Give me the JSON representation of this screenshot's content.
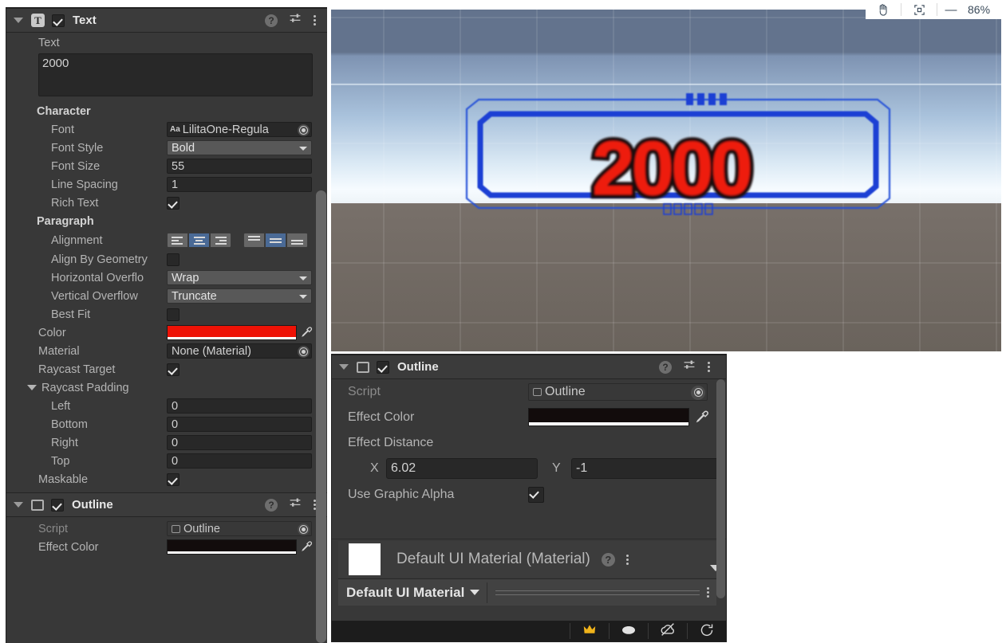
{
  "toolbar": {
    "hand_tool": "hand-tool",
    "frame_tool": "frame-selected-tool",
    "minus": "—",
    "zoom_level": "86%"
  },
  "game_view": {
    "text_value": "2000",
    "text_color": "#ee1c10",
    "outline_color": "#1a0d0d",
    "frame_color": "#1b3fd4",
    "sky_top": "#62728c",
    "sky_mid": "#b9cbdf",
    "ground": "#6e675f",
    "tick_marks_top": 4,
    "tick_marks_bottom": 5
  },
  "text_component": {
    "header": {
      "title": "Text",
      "icon": "text-component-icon",
      "enabled": true,
      "help": "help-icon",
      "preset": "preset-icon",
      "menu": "kebab-menu-icon"
    },
    "text_label": "Text",
    "text_area_value": "2000",
    "character_section": "Character",
    "font_label": "Font",
    "font_value": "LilitaOne-Regula",
    "font_icon": "Aa",
    "font_style_label": "Font Style",
    "font_style_value": "Bold",
    "font_size_label": "Font Size",
    "font_size_value": "55",
    "line_spacing_label": "Line Spacing",
    "line_spacing_value": "1",
    "rich_text_label": "Rich Text",
    "rich_text_checked": true,
    "paragraph_section": "Paragraph",
    "alignment_label": "Alignment",
    "alignment_horizontal_selected": 1,
    "alignment_vertical_selected": 1,
    "align_by_geometry_label": "Align By Geometry",
    "align_by_geometry_checked": false,
    "horizontal_overflow_label": "Horizontal Overflo",
    "horizontal_overflow_value": "Wrap",
    "vertical_overflow_label": "Vertical Overflow",
    "vertical_overflow_value": "Truncate",
    "best_fit_label": "Best Fit",
    "best_fit_checked": false,
    "color_label": "Color",
    "color_value": "#ee1206",
    "material_label": "Material",
    "material_value": "None (Material)",
    "raycast_target_label": "Raycast Target",
    "raycast_target_checked": true,
    "raycast_padding_label": "Raycast Padding",
    "padding": [
      {
        "label": "Left",
        "value": "0"
      },
      {
        "label": "Bottom",
        "value": "0"
      },
      {
        "label": "Right",
        "value": "0"
      },
      {
        "label": "Top",
        "value": "0"
      }
    ],
    "maskable_label": "Maskable",
    "maskable_checked": true
  },
  "outline_component_left": {
    "title": "Outline",
    "enabled": true,
    "script_label": "Script",
    "script_value": "Outline",
    "effect_color_label": "Effect Color",
    "effect_color_value": "#120c0c"
  },
  "outline_component_float": {
    "title": "Outline",
    "enabled": true,
    "script_label": "Script",
    "script_value": "Outline",
    "effect_color_label": "Effect Color",
    "effect_color_value": "#120c0c",
    "effect_distance_label": "Effect Distance",
    "x_label": "X",
    "x_value": "6.02",
    "y_label": "Y",
    "y_value": "-1",
    "use_graphic_alpha_label": "Use Graphic Alpha",
    "use_graphic_alpha_checked": true
  },
  "material_preview": {
    "title": "Default UI Material (Material)",
    "swatch_color": "#ffffff",
    "help": "help-icon",
    "menu": "kebab-menu-icon",
    "expand": "chevron-down-icon",
    "footer_name": "Default UI Material",
    "footer_menu": "kebab-menu-icon",
    "preview_icons": [
      "lighting-icon",
      "sphere-icon",
      "cloud-icon",
      "rotate-icon"
    ]
  }
}
